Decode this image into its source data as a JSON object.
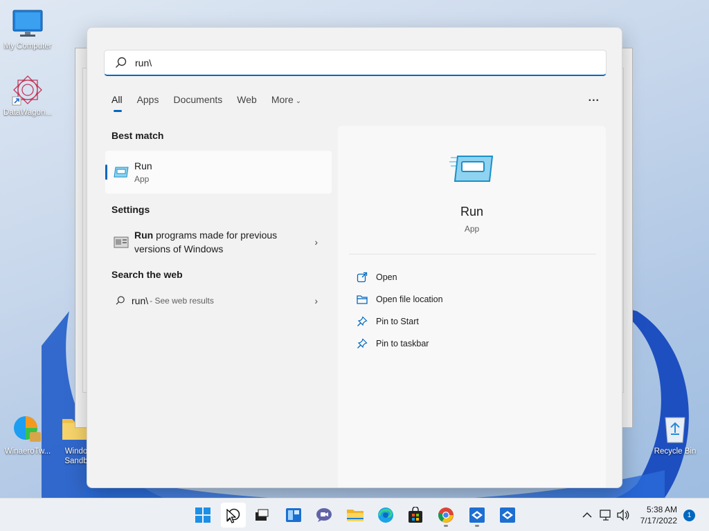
{
  "desktop": {
    "icons": [
      {
        "label": "My Computer",
        "icon": "monitor-icon"
      },
      {
        "label": "DataWagon...",
        "icon": "datawagon-icon"
      },
      {
        "label": "WinaeroTw...",
        "icon": "winaero-icon"
      },
      {
        "label": "Windo",
        "label2": "Sandb",
        "icon": "folder-icon"
      },
      {
        "label": "Recycle Bin",
        "icon": "recycle-bin-icon"
      }
    ]
  },
  "search": {
    "query": "run\\",
    "tabs": [
      "All",
      "Apps",
      "Documents",
      "Web",
      "More"
    ],
    "active_tab": "All",
    "more_menu": "..."
  },
  "results": {
    "best_match_title": "Best match",
    "best_match": {
      "name": "Run",
      "type": "App"
    },
    "settings_title": "Settings",
    "settings_item": {
      "bold": "Run",
      "rest": " programs made for previous versions of Windows"
    },
    "web_title": "Search the web",
    "web_item": {
      "query": "run\\",
      "suffix": "- See web results"
    }
  },
  "preview": {
    "name": "Run",
    "type": "App",
    "actions": [
      {
        "label": "Open",
        "icon": "open-external-icon"
      },
      {
        "label": "Open file location",
        "icon": "folder-open-icon"
      },
      {
        "label": "Pin to Start",
        "icon": "pin-icon"
      },
      {
        "label": "Pin to taskbar",
        "icon": "pin-icon"
      }
    ]
  },
  "taskbar": {
    "time": "5:38 AM",
    "date": "7/17/2022",
    "notification_count": "1"
  },
  "colors": {
    "accent": "#0067c0"
  }
}
